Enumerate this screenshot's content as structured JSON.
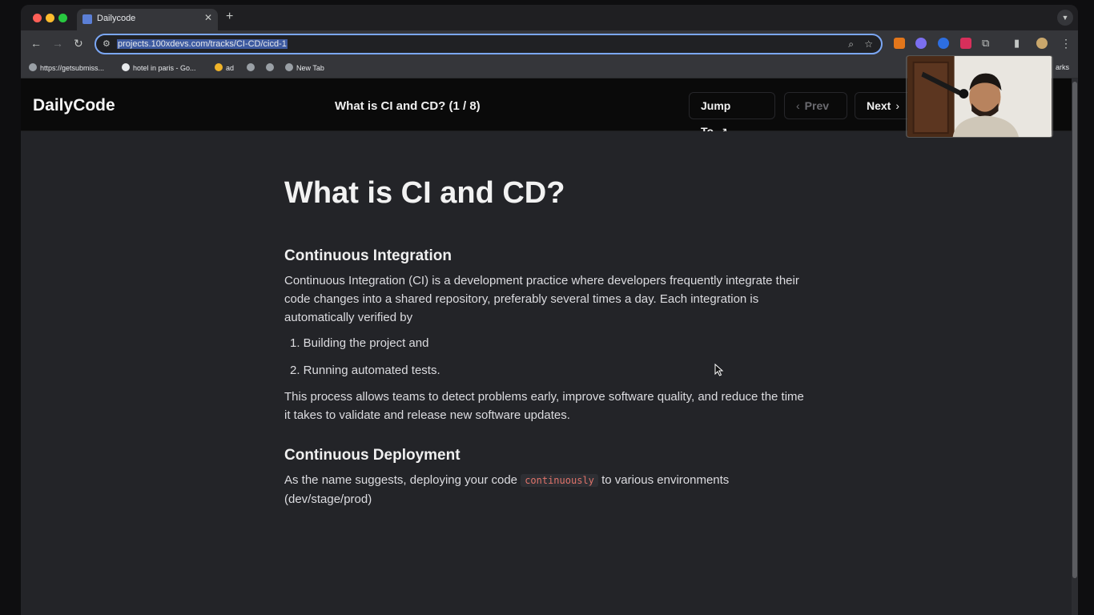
{
  "browser": {
    "tab_title": "Dailycode",
    "new_tab_symbol": "+",
    "url": "projects.100xdevs.com/tracks/CI-CD/cicd-1",
    "bookmarks": [
      {
        "label": "https://getsubmiss..."
      },
      {
        "label": "hotel in paris - Go..."
      },
      {
        "label": "ad"
      },
      {
        "label": ""
      },
      {
        "label": ""
      },
      {
        "label": "New Tab"
      }
    ],
    "bookmarks_overflow": "arks"
  },
  "header": {
    "brand": "DailyCode",
    "lesson_title": "What is CI and CD? (1 / 8)",
    "jump_to_label": "Jump To",
    "prev_label": "Prev",
    "next_label": "Next"
  },
  "article": {
    "title": "What is CI and CD?",
    "ci_heading": "Continuous Integration",
    "ci_paragraph": "Continuous Integration (CI) is a development practice where developers frequently integrate their code changes into a shared repository, preferably several times a day. Each integration is automatically verified by",
    "ci_steps": [
      "1. Building the project and",
      "2. Running automated tests."
    ],
    "ci_benefit": "This process allows teams to detect problems early, improve software quality, and reduce the time it takes to validate and release new software updates.",
    "cd_heading": "Continuous Deployment",
    "cd_text_before": "As the name suggests, deploying your code",
    "cd_code": "continuously",
    "cd_text_after": "to various environments (dev/stage/prod)"
  },
  "colors": {
    "header_bg": "#0a0a0a",
    "content_bg": "#232428",
    "code_text": "#e0736a",
    "url_highlight": "#3d5aa0"
  }
}
